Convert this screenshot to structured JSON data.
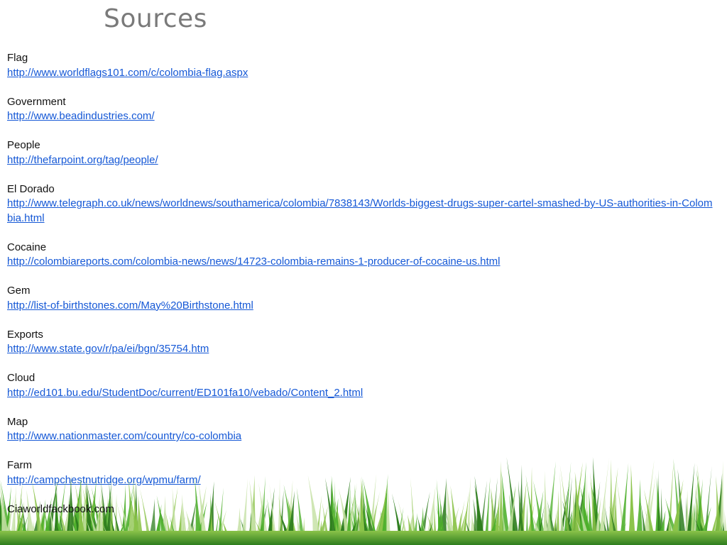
{
  "slide": {
    "title": "Sources"
  },
  "sources": [
    {
      "label": "Flag",
      "url": "http://www.worldflags101.com/c/colombia-flag.aspx"
    },
    {
      "label": "Government",
      "url": "http://www.beadindustries.com/"
    },
    {
      "label": "People",
      "url": "http://thefarpoint.org/tag/people/"
    },
    {
      "label": "El Dorado",
      "url": "http://www.telegraph.co.uk/news/worldnews/southamerica/colombia/7838143/Worlds-biggest-drugs-super-cartel-smashed-by-US-authorities-in-Colombia.html"
    },
    {
      "label": "Cocaine",
      "url": "http://colombiareports.com/colombia-news/news/14723-colombia-remains-1-producer-of-cocaine-us.html"
    },
    {
      "label": "Gem",
      "url": "http://list-of-birthstones.com/May%20Birthstone.html"
    },
    {
      "label": "Exports",
      "url": "http://www.state.gov/r/pa/ei/bgn/35754.htm"
    },
    {
      "label": "Cloud",
      "url": "http://ed101.bu.edu/StudentDoc/current/ED101fa10/vebado/Content_2.html"
    },
    {
      "label": "Map",
      "url": "http://www.nationmaster.com/country/co-colombia"
    },
    {
      "label": "Farm",
      "url": "http://campchestnutridge.org/wpmu/farm/"
    }
  ],
  "footer": {
    "note": "Ciaworldfackbook.com"
  },
  "decoration": {
    "image": "grass-border",
    "colors": [
      "#2e7d1e",
      "#4caf2a",
      "#8bc34a",
      "#c5e1a5"
    ]
  }
}
